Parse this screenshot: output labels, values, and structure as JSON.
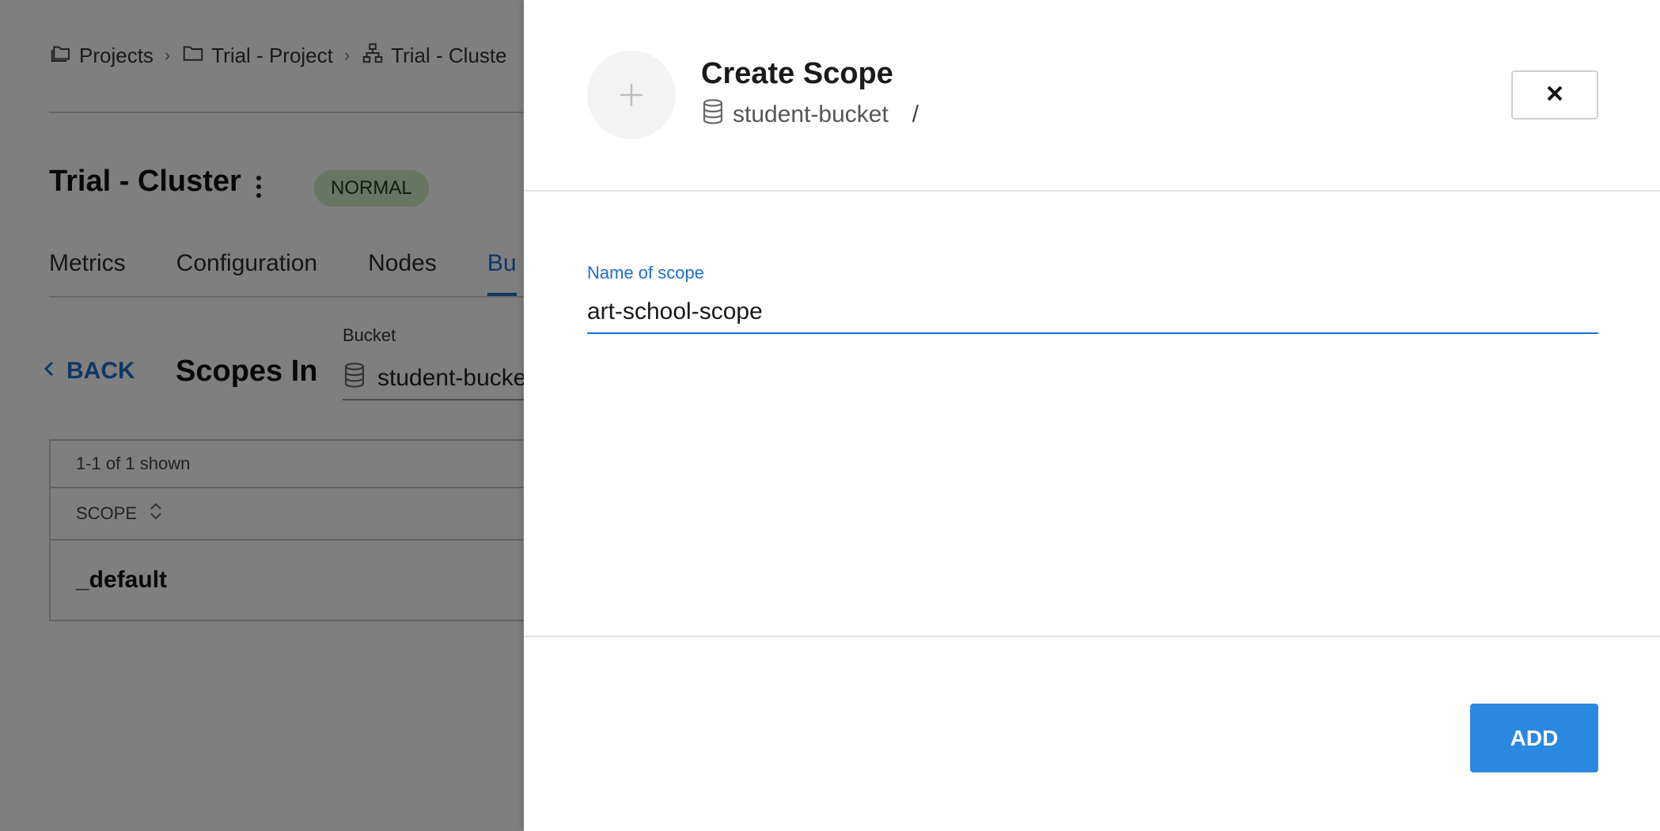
{
  "breadcrumb": {
    "items": [
      "Projects",
      "Trial - Project",
      "Trial - Cluste"
    ]
  },
  "cluster": {
    "title": "Trial - Cluster",
    "status": "NORMAL"
  },
  "tabs": [
    {
      "label": "Metrics"
    },
    {
      "label": "Configuration"
    },
    {
      "label": "Nodes"
    },
    {
      "label": "Bu"
    }
  ],
  "scopes_section": {
    "back_label": "BACK",
    "title": "Scopes In",
    "bucket_label": "Bucket",
    "bucket_value": "student-bucke"
  },
  "table": {
    "shown_text": "1-1 of 1 shown",
    "column_header": "SCOPE",
    "rows": [
      "_default"
    ]
  },
  "panel": {
    "title": "Create Scope",
    "bucket": "student-bucket",
    "path_separator": "/",
    "field_label": "Name of scope",
    "field_value": "art-school-scope",
    "add_label": "ADD"
  },
  "colors": {
    "accent": "#2b88e0",
    "link": "#1e6fcf",
    "status_bg": "#cfeac4"
  }
}
